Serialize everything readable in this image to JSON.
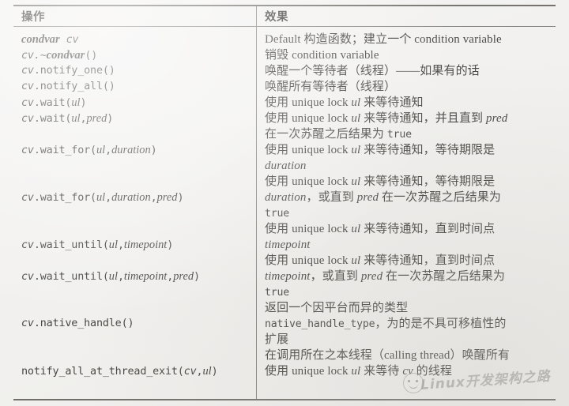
{
  "table": {
    "headers": {
      "operation": "操作",
      "effect": "效果"
    },
    "rows": [
      {
        "op_lines": [
          [
            {
              "t": "condvar",
              "s": "bi"
            },
            {
              "t": " ",
              "s": "sp"
            },
            {
              "t": "cv",
              "s": "cv"
            }
          ]
        ],
        "eff_lines": [
          [
            {
              "t": "Default ",
              "s": "en"
            },
            {
              "t": "构造函数；建立一个 ",
              "s": "cn"
            },
            {
              "t": "condition variable",
              "s": "en"
            }
          ]
        ]
      },
      {
        "op_lines": [
          [
            {
              "t": "cv.~",
              "s": "cv"
            },
            {
              "t": "condvar",
              "s": "bi"
            },
            {
              "t": "()",
              "s": "mono"
            }
          ]
        ],
        "eff_lines": [
          [
            {
              "t": "销毁 ",
              "s": "cn"
            },
            {
              "t": "condition variable",
              "s": "en"
            }
          ]
        ]
      },
      {
        "op_lines": [
          [
            {
              "t": "cv",
              "s": "cv"
            },
            {
              "t": ".notify_one()",
              "s": "mono"
            }
          ]
        ],
        "eff_lines": [
          [
            {
              "t": "唤醒一个等待者（线程）——如果有的话",
              "s": "cn"
            }
          ]
        ]
      },
      {
        "op_lines": [
          [
            {
              "t": "cv",
              "s": "cv"
            },
            {
              "t": ".notify_all()",
              "s": "mono"
            }
          ]
        ],
        "eff_lines": [
          [
            {
              "t": "唤醒所有等待者（线程）",
              "s": "cn"
            }
          ]
        ]
      },
      {
        "op_lines": [
          [
            {
              "t": "cv",
              "s": "cv"
            },
            {
              "t": ".wait(",
              "s": "mono"
            },
            {
              "t": "ul",
              "s": "it"
            },
            {
              "t": ")",
              "s": "mono"
            }
          ]
        ],
        "eff_lines": [
          [
            {
              "t": "使用 ",
              "s": "cn"
            },
            {
              "t": "unique lock ",
              "s": "en"
            },
            {
              "t": "ul",
              "s": "it"
            },
            {
              "t": " 来等待通知",
              "s": "cn"
            }
          ]
        ]
      },
      {
        "op_lines": [
          [
            {
              "t": "cv",
              "s": "cv"
            },
            {
              "t": ".wait(",
              "s": "mono"
            },
            {
              "t": "ul",
              "s": "it"
            },
            {
              "t": ",",
              "s": "mono"
            },
            {
              "t": "pred",
              "s": "it"
            },
            {
              "t": ")",
              "s": "mono"
            }
          ]
        ],
        "eff_lines": [
          [
            {
              "t": "使用 ",
              "s": "cn"
            },
            {
              "t": "unique lock ",
              "s": "en"
            },
            {
              "t": "ul",
              "s": "it"
            },
            {
              "t": " 来等待通知，并且直到 ",
              "s": "cn"
            },
            {
              "t": "pred",
              "s": "it"
            }
          ],
          [
            {
              "t": "在一次苏醒之后结果为 ",
              "s": "cn"
            },
            {
              "t": "true",
              "s": "mono"
            }
          ]
        ]
      },
      {
        "op_lines": [
          [
            {
              "t": "cv",
              "s": "cv"
            },
            {
              "t": ".wait_for(",
              "s": "mono"
            },
            {
              "t": "ul",
              "s": "it"
            },
            {
              "t": ",",
              "s": "mono"
            },
            {
              "t": "duration",
              "s": "it"
            },
            {
              "t": ")",
              "s": "mono"
            }
          ]
        ],
        "eff_lines": [
          [
            {
              "t": "使用 ",
              "s": "cn"
            },
            {
              "t": "unique lock ",
              "s": "en"
            },
            {
              "t": "ul",
              "s": "it"
            },
            {
              "t": " 来等待通知，等待期限是",
              "s": "cn"
            }
          ],
          [
            {
              "t": "duration",
              "s": "it"
            }
          ]
        ]
      },
      {
        "op_lines": [
          [
            {
              "t": "cv",
              "s": "cv"
            },
            {
              "t": ".wait_for(",
              "s": "mono"
            },
            {
              "t": "ul",
              "s": "it"
            },
            {
              "t": ",",
              "s": "mono"
            },
            {
              "t": "duration",
              "s": "it"
            },
            {
              "t": ",",
              "s": "mono"
            },
            {
              "t": "pred",
              "s": "it"
            },
            {
              "t": ")",
              "s": "mono"
            }
          ]
        ],
        "eff_lines": [
          [
            {
              "t": "使用 ",
              "s": "cn"
            },
            {
              "t": "unique lock ",
              "s": "en"
            },
            {
              "t": "ul",
              "s": "it"
            },
            {
              "t": " 来等待通知，等待期限是",
              "s": "cn"
            }
          ],
          [
            {
              "t": "duration",
              "s": "it"
            },
            {
              "t": "，或直到 ",
              "s": "cn"
            },
            {
              "t": "pred",
              "s": "it"
            },
            {
              "t": " 在一次苏醒之后结果为",
              "s": "cn"
            }
          ],
          [
            {
              "t": "true",
              "s": "mono"
            }
          ]
        ]
      },
      {
        "op_lines": [
          [
            {
              "t": "cv",
              "s": "cv"
            },
            {
              "t": ".wait_until(",
              "s": "mono"
            },
            {
              "t": "ul",
              "s": "it"
            },
            {
              "t": ",",
              "s": "mono"
            },
            {
              "t": "timepoint",
              "s": "it"
            },
            {
              "t": ")",
              "s": "mono"
            }
          ]
        ],
        "eff_lines": [
          [
            {
              "t": "使用 ",
              "s": "cn"
            },
            {
              "t": "unique lock ",
              "s": "en"
            },
            {
              "t": "ul",
              "s": "it"
            },
            {
              "t": " 来等待通知，直到时间点",
              "s": "cn"
            }
          ],
          [
            {
              "t": "timepoint",
              "s": "it"
            }
          ]
        ]
      },
      {
        "op_lines": [
          [
            {
              "t": "cv",
              "s": "cv"
            },
            {
              "t": ".wait_until(",
              "s": "mono"
            },
            {
              "t": "ul",
              "s": "it"
            },
            {
              "t": ",",
              "s": "mono"
            },
            {
              "t": "timepoint",
              "s": "it"
            },
            {
              "t": ",",
              "s": "mono"
            },
            {
              "t": "pred",
              "s": "it"
            },
            {
              "t": ")",
              "s": "mono"
            }
          ]
        ],
        "eff_lines": [
          [
            {
              "t": "使用 ",
              "s": "cn"
            },
            {
              "t": "unique lock ",
              "s": "en"
            },
            {
              "t": "ul",
              "s": "it"
            },
            {
              "t": " 来等待通知，直到时间点",
              "s": "cn"
            }
          ],
          [
            {
              "t": "timepoint",
              "s": "it"
            },
            {
              "t": "，或直到 ",
              "s": "cn"
            },
            {
              "t": "pred",
              "s": "it"
            },
            {
              "t": " 在一次苏醒之后结果为",
              "s": "cn"
            }
          ],
          [
            {
              "t": "true",
              "s": "mono"
            }
          ]
        ]
      },
      {
        "op_lines": [
          [
            {
              "t": "cv",
              "s": "cv"
            },
            {
              "t": ".native_handle()",
              "s": "mono"
            }
          ]
        ],
        "eff_lines": [
          [
            {
              "t": "返回一个因平台而异的类型",
              "s": "cn"
            }
          ],
          [
            {
              "t": "native_handle_type",
              "s": "mono"
            },
            {
              "t": "，为的是不具可移植性的",
              "s": "cn"
            }
          ],
          [
            {
              "t": "扩展",
              "s": "cn"
            }
          ]
        ]
      },
      {
        "op_lines": [
          [
            {
              "t": "notify_all_at_thread_exit(",
              "s": "mono"
            },
            {
              "t": "cv",
              "s": "cv"
            },
            {
              "t": ",",
              "s": "mono"
            },
            {
              "t": "ul",
              "s": "it"
            },
            {
              "t": ")",
              "s": "mono"
            }
          ]
        ],
        "eff_lines": [
          [
            {
              "t": "在调用所在之本线程（",
              "s": "cn"
            },
            {
              "t": "calling thread",
              "s": "en"
            },
            {
              "t": "）唤醒所有",
              "s": "cn"
            }
          ],
          [
            {
              "t": "使用 ",
              "s": "cn"
            },
            {
              "t": "unique lock ",
              "s": "en"
            },
            {
              "t": "ul",
              "s": "it"
            },
            {
              "t": " 来等待 ",
              "s": "cn"
            },
            {
              "t": "cv",
              "s": "cvd"
            },
            {
              "t": " 的线程",
              "s": "cn"
            }
          ]
        ]
      }
    ],
    "row_tops": {
      "op": [
        4,
        24,
        44,
        64,
        84,
        104,
        144,
        204,
        264,
        304,
        364,
        424
      ],
      "eff": [
        4,
        24,
        44,
        64,
        84,
        104,
        144,
        184,
        244,
        284,
        344,
        404
      ]
    }
  },
  "watermark": {
    "text": "Linux开发架构之路",
    "icon": "smiley-face-icon"
  }
}
